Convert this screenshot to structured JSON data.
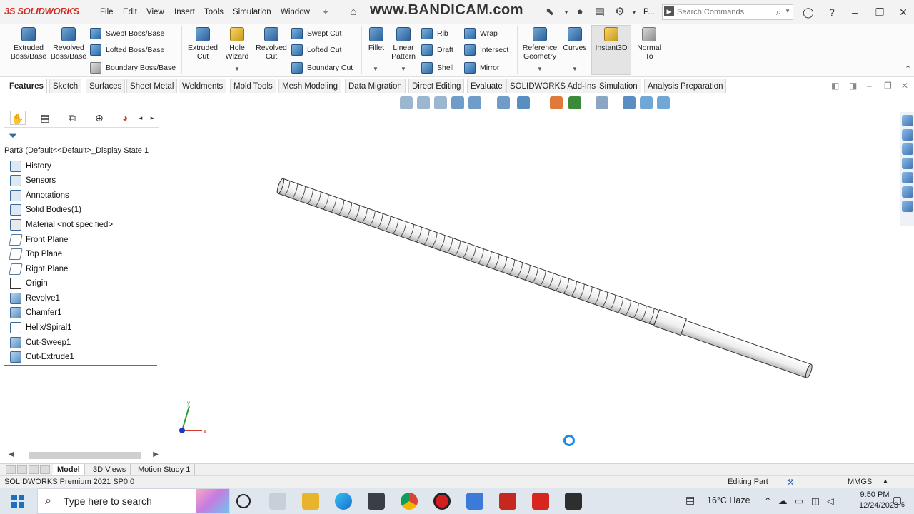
{
  "app": {
    "brand": "SOLIDWORKS",
    "menus": [
      "File",
      "Edit",
      "View",
      "Insert",
      "Tools",
      "Simulation",
      "Window"
    ],
    "watermark": "www.BANDICAM.com",
    "partial_label": "P...",
    "search_placeholder": "Search Commands"
  },
  "ribbon": {
    "extruded_boss": "Extruded Boss/Base",
    "revolved_boss": "Revolved Boss/Base",
    "swept_boss": "Swept Boss/Base",
    "lofted_boss": "Lofted Boss/Base",
    "boundary_boss": "Boundary Boss/Base",
    "extruded_cut": "Extruded Cut",
    "hole_wizard": "Hole Wizard",
    "revolved_cut": "Revolved Cut",
    "swept_cut": "Swept Cut",
    "lofted_cut": "Lofted Cut",
    "boundary_cut": "Boundary Cut",
    "fillet": "Fillet",
    "linear_pattern": "Linear Pattern",
    "rib": "Rib",
    "draft": "Draft",
    "shell": "Shell",
    "wrap": "Wrap",
    "intersect": "Intersect",
    "mirror": "Mirror",
    "reference_geometry": "Reference Geometry",
    "curves": "Curves",
    "instant3d": "Instant3D",
    "normal_to": "Normal To"
  },
  "command_tabs": [
    "Features",
    "Sketch",
    "Surfaces",
    "Sheet Metal",
    "Weldments",
    "Mold Tools",
    "Mesh Modeling",
    "Data Migration",
    "Direct Editing",
    "Evaluate",
    "SOLIDWORKS Add-Ins",
    "Simulation",
    "Analysis Preparation"
  ],
  "active_command_tab": "Features",
  "tree": {
    "part": "Part3  (Default<<Default>_Display State 1",
    "items": [
      "History",
      "Sensors",
      "Annotations",
      "Solid Bodies(1)",
      "Material <not specified>",
      "Front Plane",
      "Top Plane",
      "Right Plane",
      "Origin",
      "Revolve1",
      "Chamfer1",
      "Helix/Spiral1",
      "Cut-Sweep1",
      "Cut-Extrude1"
    ]
  },
  "bottom_tabs": [
    "Model",
    "3D Views",
    "Motion Study 1"
  ],
  "status": {
    "version": "SOLIDWORKS Premium 2021 SP0.0",
    "mode": "Editing Part",
    "units": "MMGS"
  },
  "taskbar": {
    "search_placeholder": "Type here to search",
    "weather": "16°C  Haze",
    "time": "9:50 PM",
    "date": "12/24/2023",
    "notification_count": "5"
  },
  "colors": {
    "brand_red": "#d52b1e",
    "selection_blue": "#2e7bbf",
    "spinner_blue": "#1e88e5"
  }
}
